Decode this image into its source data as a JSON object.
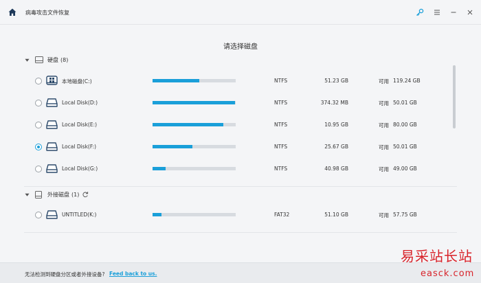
{
  "app": {
    "title": "病毒攻击文件恢复"
  },
  "main": {
    "title": "请选择磁盘"
  },
  "groups": [
    {
      "label": "硬盘",
      "count": "(8)"
    },
    {
      "label": "外接磁盘",
      "count": "(1)"
    }
  ],
  "drives": [
    {
      "name": "本地磁盘(C:)",
      "fs": "NTFS",
      "used": "51.23 GB",
      "avail_label": "可用",
      "avail": "119.24 GB",
      "fill": 0.56,
      "selected": false,
      "icon": "windows-drive-icon"
    },
    {
      "name": "Local Disk(D:)",
      "fs": "NTFS",
      "used": "374.32 MB",
      "avail_label": "可用",
      "avail": "50.01 GB",
      "fill": 0.99,
      "selected": false,
      "icon": "hard-drive-icon"
    },
    {
      "name": "Local Disk(E:)",
      "fs": "NTFS",
      "used": "10.95 GB",
      "avail_label": "可用",
      "avail": "80.00 GB",
      "fill": 0.85,
      "selected": false,
      "icon": "hard-drive-icon"
    },
    {
      "name": "Local Disk(F:)",
      "fs": "NTFS",
      "used": "25.67 GB",
      "avail_label": "可用",
      "avail": "50.01 GB",
      "fill": 0.48,
      "selected": true,
      "icon": "hard-drive-icon"
    },
    {
      "name": "Local Disk(G:)",
      "fs": "NTFS",
      "used": "40.98 GB",
      "avail_label": "可用",
      "avail": "49.00 GB",
      "fill": 0.16,
      "selected": false,
      "icon": "hard-drive-icon"
    },
    {
      "name": "UNTITLED(K:)",
      "fs": "FAT32",
      "used": "51.10 GB",
      "avail_label": "可用",
      "avail": "57.75 GB",
      "fill": 0.11,
      "selected": false,
      "icon": "hard-drive-icon"
    }
  ],
  "footer": {
    "text": "无法检测到硬盘分区或者外接设备?",
    "link": "Feed back to us."
  },
  "watermark": {
    "cn": "易采站长站",
    "en": "easck.com"
  },
  "colors": {
    "accent": "#1a9fd9",
    "track": "#d7dbe0",
    "watermark": "#d8232a"
  }
}
